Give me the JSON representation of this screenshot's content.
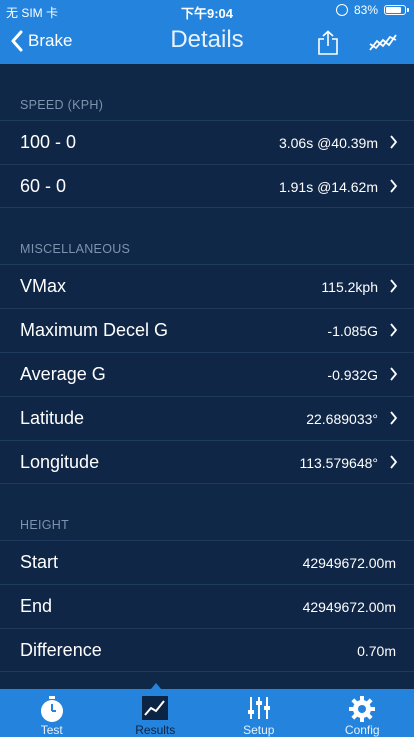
{
  "status": {
    "carrier": "无 SIM 卡",
    "time": "下午9:04",
    "battery": "83%",
    "battery_level": 0.83
  },
  "nav": {
    "back_label": "Brake",
    "title": "Details"
  },
  "sections": [
    {
      "header": "SPEED (KPH)",
      "rows": [
        {
          "label": "100 - 0",
          "value": "3.06s @40.39m"
        },
        {
          "label": "60 - 0",
          "value": "1.91s @14.62m"
        }
      ]
    },
    {
      "header": "MISCELLANEOUS",
      "rows": [
        {
          "label": "VMax",
          "value": "115.2kph"
        },
        {
          "label": "Maximum Decel G",
          "value": "-1.085G"
        },
        {
          "label": "Average G",
          "value": "-0.932G"
        },
        {
          "label": "Latitude",
          "value": "22.689033°"
        },
        {
          "label": "Longitude",
          "value": "113.579648°"
        }
      ]
    },
    {
      "header": "HEIGHT",
      "rows": [
        {
          "label": "Start",
          "value": "42949672.00m"
        },
        {
          "label": "End",
          "value": "42949672.00m"
        },
        {
          "label": "Difference",
          "value": "0.70m"
        }
      ]
    }
  ],
  "tabs": [
    {
      "label": "Test",
      "icon": "stopwatch-icon"
    },
    {
      "label": "Results",
      "icon": "chart-icon"
    },
    {
      "label": "Setup",
      "icon": "sliders-icon"
    },
    {
      "label": "Config",
      "icon": "gear-icon"
    }
  ],
  "colors": {
    "accent": "#2484dd",
    "background": "#102847"
  }
}
